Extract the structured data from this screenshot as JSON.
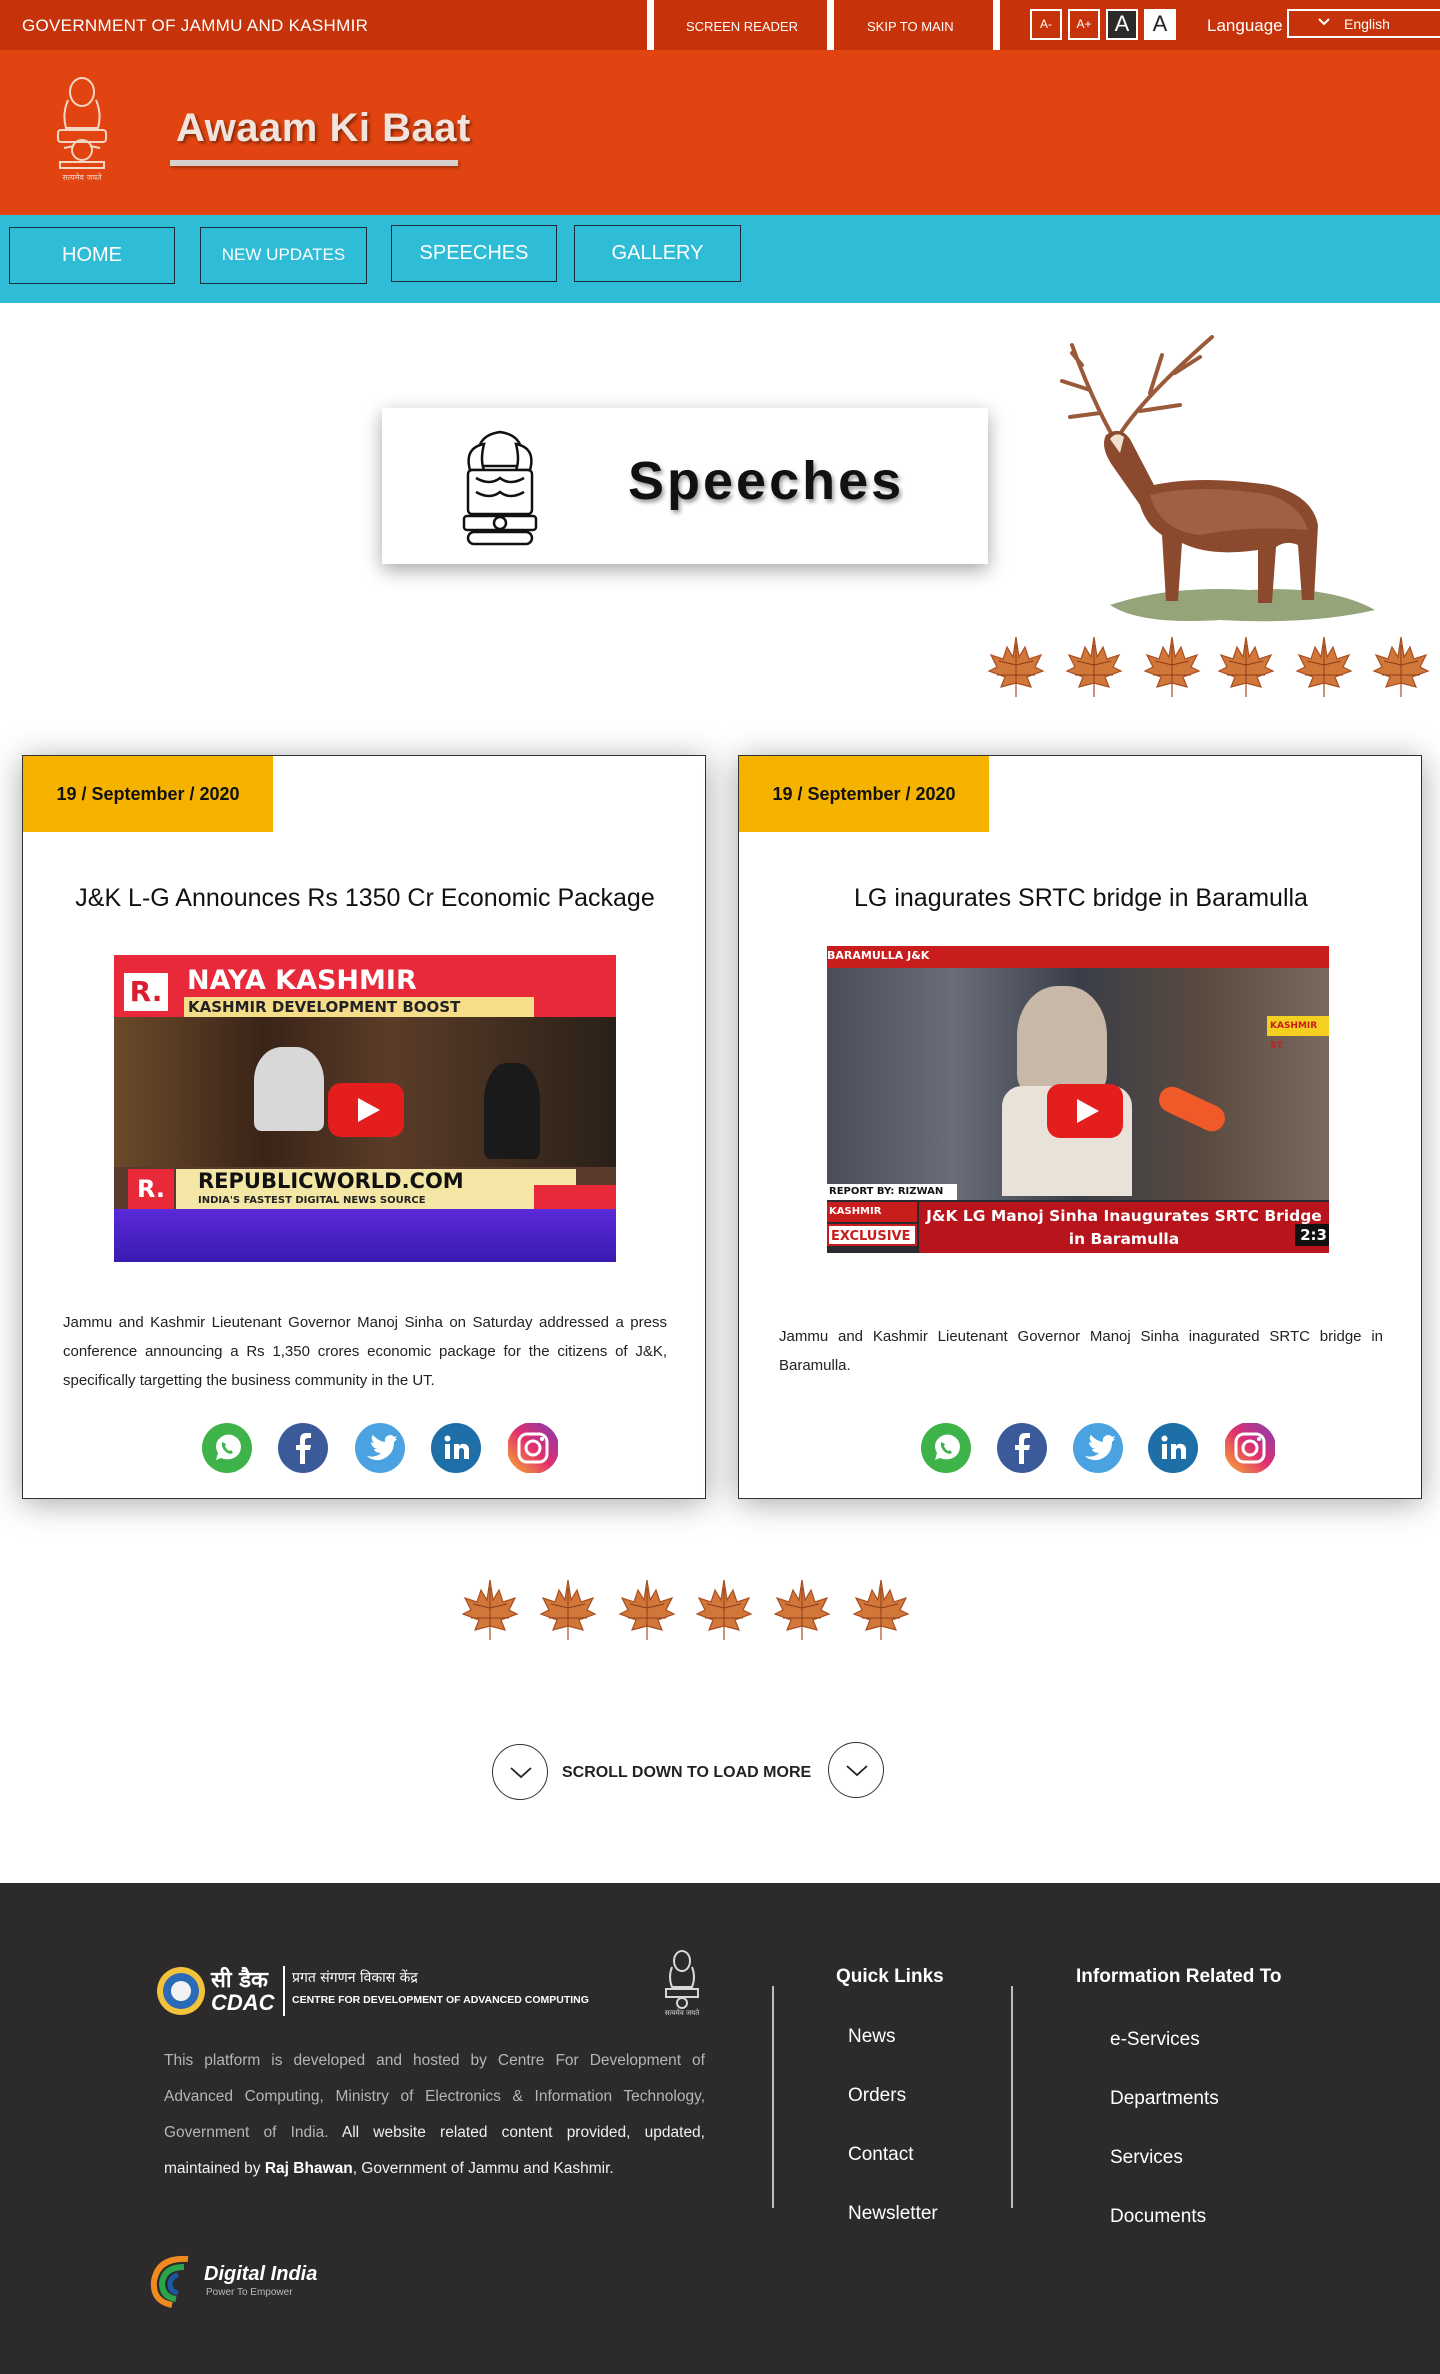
{
  "topbar": {
    "government": "GOVERNMENT OF JAMMU AND KASHMIR",
    "screen_reader": "SCREEN READER",
    "skip_to_main": "SKIP TO MAIN",
    "font_decrease": "A-",
    "font_increase": "A+",
    "contrast_dark": "A",
    "contrast_light": "A",
    "language_label": "Language",
    "language_value": "English"
  },
  "header": {
    "site_title": "Awaam Ki Baat",
    "emblem_motto": "सत्यमेव जयते"
  },
  "nav": {
    "items": [
      {
        "label": "HOME"
      },
      {
        "label": "NEW UPDATES"
      },
      {
        "label": "SPEECHES"
      },
      {
        "label": "GALLERY"
      }
    ]
  },
  "banner": {
    "title": "Speeches"
  },
  "cards": [
    {
      "date": "19 / September / 2020",
      "title": "J&K L-G   Announces Rs 1350 Cr Economic Package",
      "video": {
        "top_banner": "NAYA KASHMIR",
        "sub_banner": "KASHMIR DEVELOPMENT BOOST",
        "bottom_banner": "REPUBLICWORLD.COM",
        "bottom_sub": "INDIA'S FASTEST DIGITAL NEWS SOURCE",
        "logo": "R."
      },
      "description": "Jammu and Kashmir Lieutenant Governor Manoj Sinha on Saturday addressed a press conference announcing a Rs 1,350 crores economic package for the citizens of J&K, specifically targetting the business community in the UT."
    },
    {
      "date": "19 / September / 2020",
      "title": "LG inagurates SRTC bridge in Baramulla",
      "video": {
        "corner_label": "BARAMULLA J&K",
        "reporter": "REPORT BY: RIZWAN MIR",
        "tag1": "KASHMIR CROWN",
        "tag2": "EXCLUSIVE",
        "headline": "J&K LG Manoj Sinha Inaugurates SRTC Bridge in Baramulla",
        "side_tag": "KASHMIR ST",
        "duration": "2:3"
      },
      "description": "Jammu and Kashmir Lieutenant Governor Manoj Sinha inagurated SRTC bridge in Baramulla."
    }
  ],
  "social_icons": [
    "whatsapp-icon",
    "facebook-icon",
    "twitter-icon",
    "linkedin-icon",
    "instagram-icon"
  ],
  "scroll_more": {
    "label": "SCROLL DOWN TO LOAD MORE"
  },
  "footer": {
    "cdac_hindi": "सी डैक",
    "cdac_hindi_full": "प्रगत संगणन विकास केंद्र",
    "cdac_english": "CENTRE FOR DEVELOPMENT OF ADVANCED COMPUTING",
    "cdac_short": "CDAC",
    "about_grey": "This platform is developed and hosted by Centre For Development of Advanced Computing, Ministry of Electronics & Information Technology, Government of India.",
    "about_white_1": "All website related content provided, updated, maintained  by",
    "about_bold": "Raj Bhawan",
    "about_white_2": ", Government of Jammu and Kashmir.",
    "quick_links_heading": "Quick Links",
    "quick_links": [
      "News",
      "Orders",
      "Contact",
      "Newsletter"
    ],
    "info_heading": "Information Related To",
    "info_links": [
      "e-Services",
      "Departments",
      "Services",
      "Documents"
    ],
    "digital_india": "Digital India",
    "digital_india_tagline": "Power To Empower"
  },
  "colors": {
    "topbar": "#c6330a",
    "header": "#e14410",
    "nav": "#2fbcd7",
    "date_badge": "#f5b300",
    "footer": "#2c2a2a"
  }
}
